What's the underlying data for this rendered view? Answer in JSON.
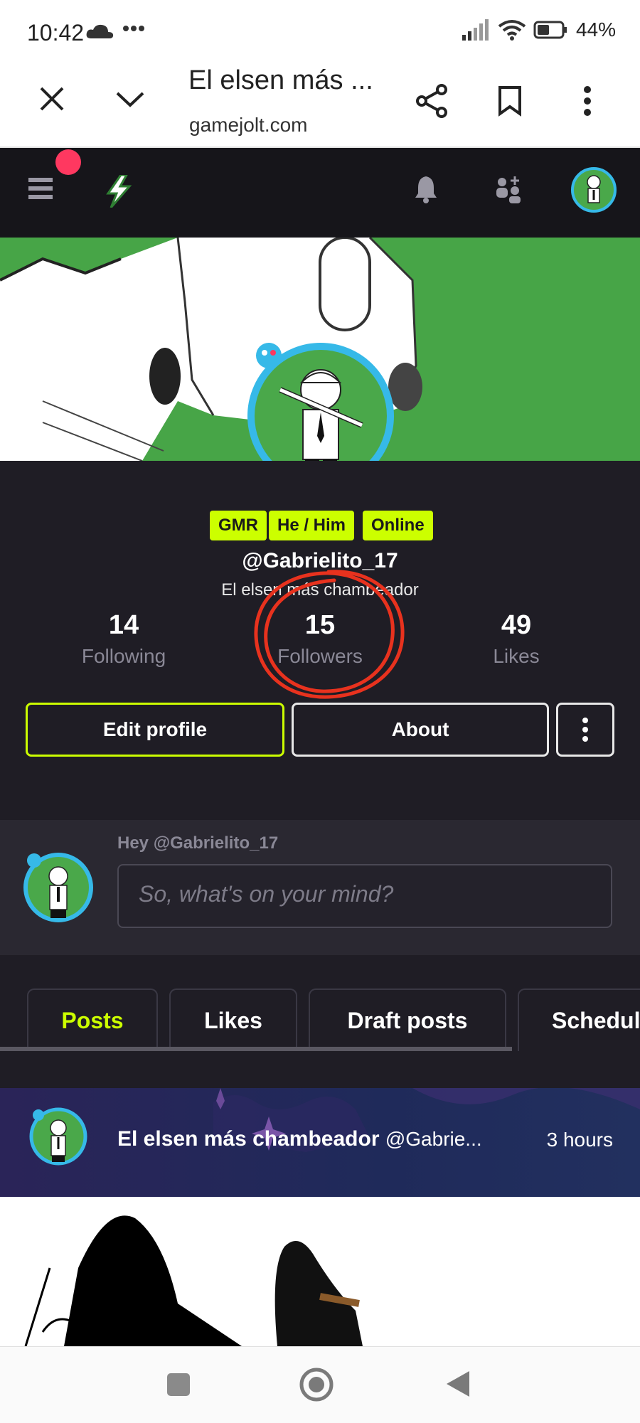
{
  "status_bar": {
    "time": "10:42",
    "battery": "44%"
  },
  "browser": {
    "page_title": "El elsen más ...",
    "url": "gamejolt.com"
  },
  "profile": {
    "tags": [
      "GMR",
      "He / Him",
      "Online"
    ],
    "username": "@Gabrielito_17",
    "display_name": "El elsen más chambeador",
    "stats": [
      {
        "value": "14",
        "label": "Following"
      },
      {
        "value": "15",
        "label": "Followers"
      },
      {
        "value": "49",
        "label": "Likes"
      }
    ],
    "buttons": {
      "edit": "Edit profile",
      "about": "About"
    }
  },
  "composer": {
    "greeting": "Hey @Gabrielito_17",
    "placeholder": "So, what's on your mind?"
  },
  "tabs": [
    "Posts",
    "Likes",
    "Draft posts",
    "Schedul"
  ],
  "post": {
    "author": "El elsen más chambeador",
    "handle": "@Gabrie...",
    "time": "3 hours"
  },
  "colors": {
    "accent": "#ccff00",
    "annotation": "#e8321e",
    "header_bg": "#16151a",
    "profile_bg": "#1f1d25",
    "notif": "#ff3860"
  }
}
